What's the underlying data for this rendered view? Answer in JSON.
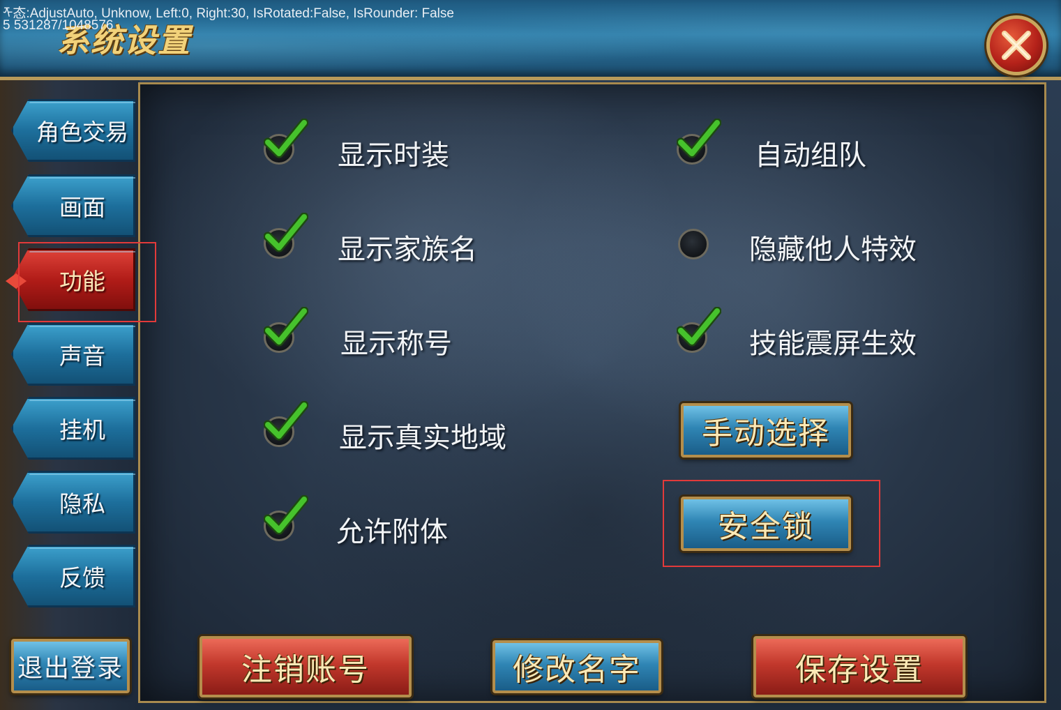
{
  "debug": {
    "line1": "ᡯ态:AdjustAuto, Unknow, Left:0, Right:30, IsRotated:False, IsRounder: False",
    "line2": "5 531287/1048576"
  },
  "window": {
    "title": "系统设置",
    "close_icon": "close-x-icon"
  },
  "sidebar": {
    "items": [
      {
        "label": "角色交易"
      },
      {
        "label": "画面"
      },
      {
        "label": "功能",
        "active": true
      },
      {
        "label": "声音"
      },
      {
        "label": "挂机"
      },
      {
        "label": "隐私"
      },
      {
        "label": "反馈"
      }
    ],
    "logout_label": "退出登录"
  },
  "options": {
    "left": [
      {
        "label": "显示时装",
        "checked": true
      },
      {
        "label": "显示家族名",
        "checked": true
      },
      {
        "label": "显示称号",
        "checked": true
      },
      {
        "label": "显示真实地域",
        "checked": true
      },
      {
        "label": "允许附体",
        "checked": true
      }
    ],
    "right": [
      {
        "label": "自动组队",
        "checked": true
      },
      {
        "label": "隐藏他人特效",
        "checked": false
      },
      {
        "label": "技能震屏生效",
        "checked": true
      }
    ]
  },
  "buttons": {
    "manual_select": "手动选择",
    "security_lock": "安全锁",
    "cancel_account": "注销账号",
    "rename": "修改名字",
    "save_settings": "保存设置"
  },
  "colors": {
    "check_green": "#3fbf2a",
    "highlight_red": "#e23a3a",
    "gold_border": "#b48e4c"
  }
}
